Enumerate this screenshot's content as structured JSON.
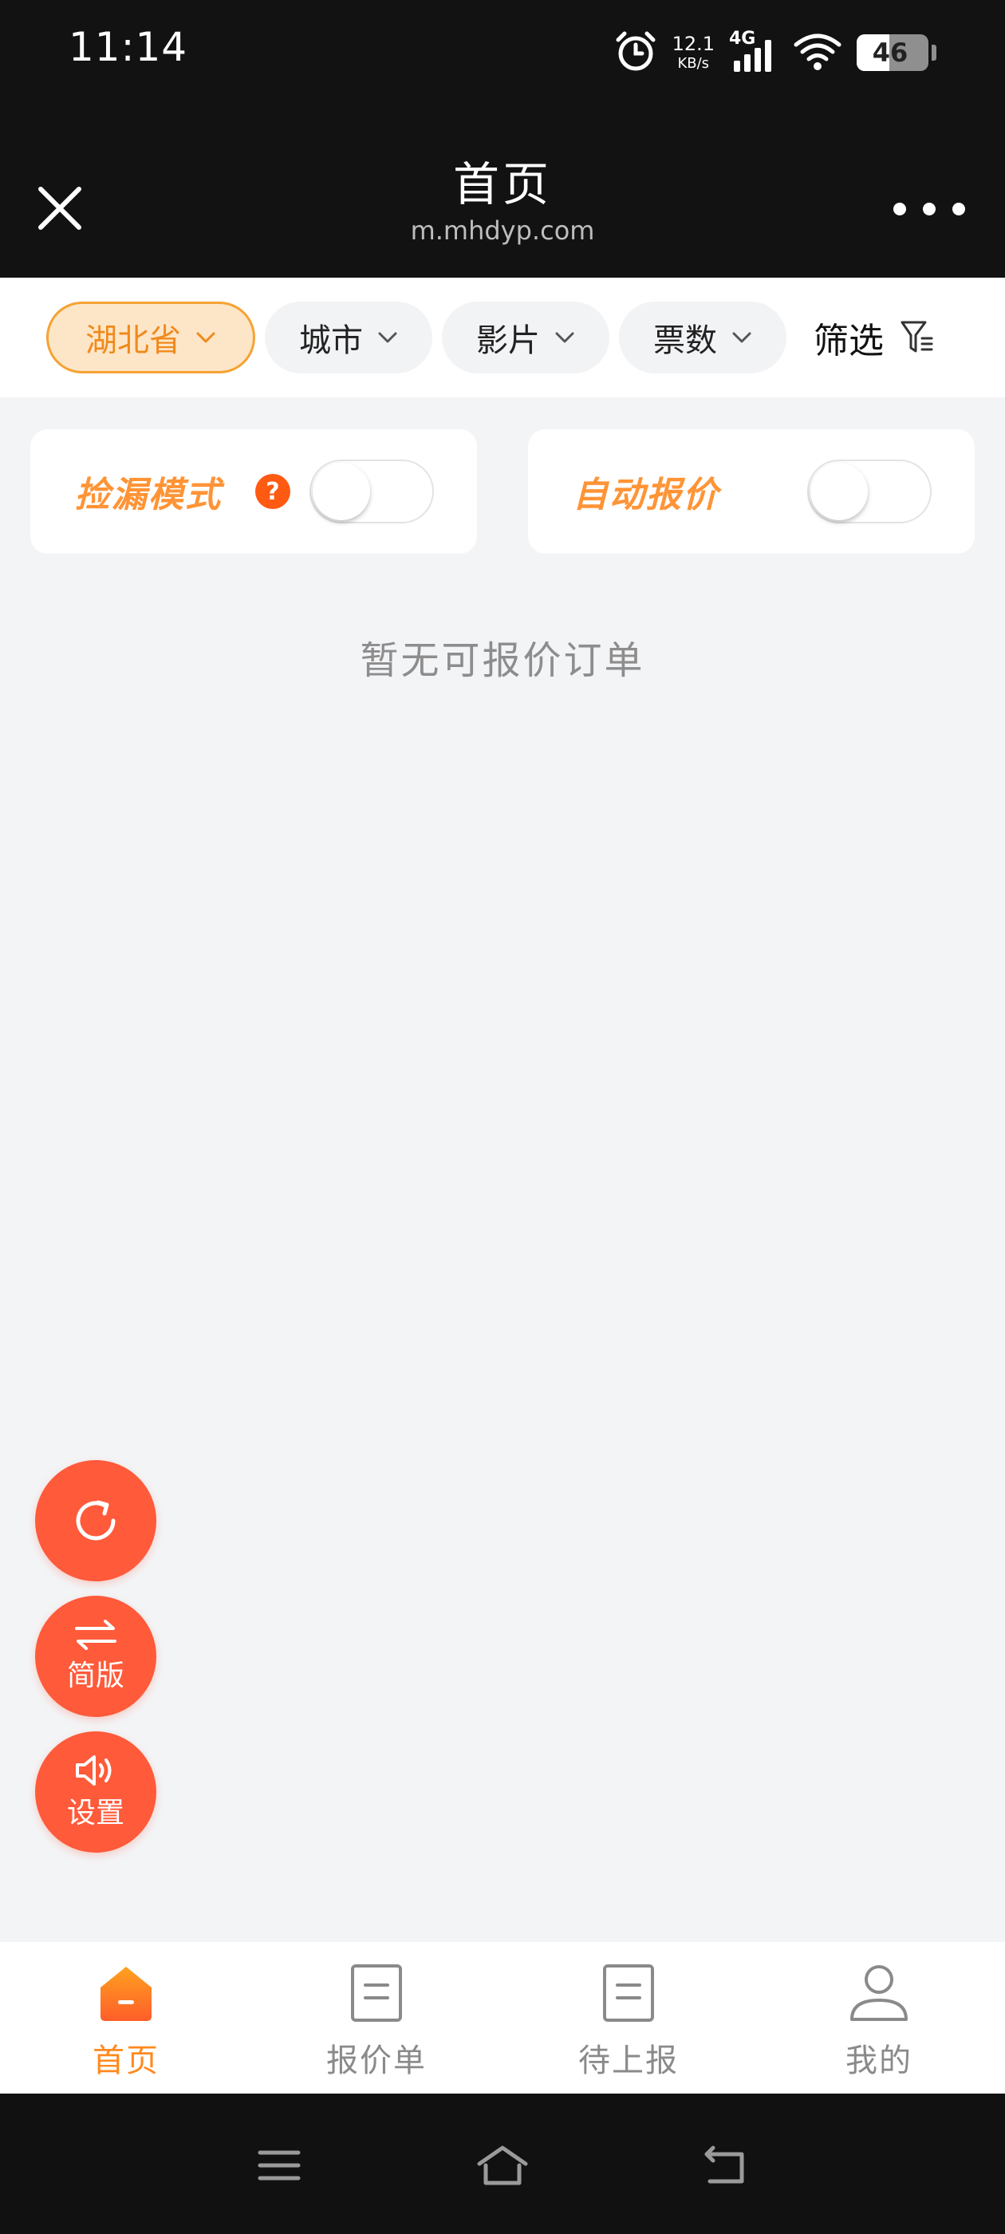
{
  "status_bar": {
    "time": "11:14",
    "net_speed_value": "12.1",
    "net_speed_unit": "KB/s",
    "network_type": "4G",
    "battery_level": "46",
    "icons": [
      "alarm-icon",
      "signal-icon",
      "wifi-icon",
      "battery-icon"
    ]
  },
  "title_bar": {
    "title": "首页",
    "subtitle": "m.mhdyp.com",
    "icons": [
      "close-icon",
      "more-icon"
    ]
  },
  "filters": {
    "chips": [
      {
        "label": "湖北省",
        "active": true
      },
      {
        "label": "城市",
        "active": false
      },
      {
        "label": "影片",
        "active": false
      },
      {
        "label": "票数",
        "active": false
      }
    ],
    "filter_label": "筛选"
  },
  "cards": {
    "bargain_mode": {
      "label": "捡漏模式",
      "help": "?",
      "enabled": false
    },
    "auto_quote": {
      "label": "自动报价",
      "enabled": false
    }
  },
  "empty_text": "暂无可报价订单",
  "fabs": [
    {
      "label": "",
      "icon": "refresh-icon"
    },
    {
      "label": "简版",
      "icon": "swap-icon"
    },
    {
      "label": "设置",
      "icon": "speaker-icon"
    }
  ],
  "bottom_nav": [
    {
      "label": "首页",
      "icon": "home-icon",
      "active": true
    },
    {
      "label": "报价单",
      "icon": "document-icon",
      "active": false
    },
    {
      "label": "待上报",
      "icon": "document-icon",
      "active": false
    },
    {
      "label": "我的",
      "icon": "user-icon",
      "active": false
    }
  ],
  "colors": {
    "accent": "#ff8a1f",
    "fab": "#ff5a3a",
    "chip_active_bg": "#fde6c8",
    "chip_active_border": "#f6a233",
    "help": "#ff5a12"
  }
}
